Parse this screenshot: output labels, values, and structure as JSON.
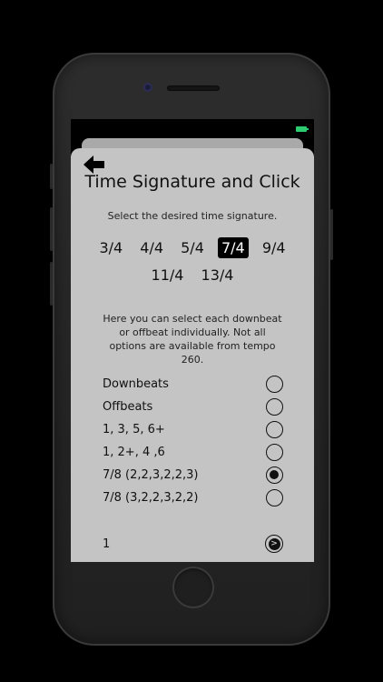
{
  "title": "Time Signature and Click",
  "subtitle": "Select the desired time signature.",
  "signatures_row1": [
    "3/4",
    "4/4",
    "5/4",
    "7/4",
    "9/4"
  ],
  "signatures_row2": [
    "11/4",
    "13/4"
  ],
  "selected_signature": "7/4",
  "info_text": "Here you can select each downbeat or offbeat individually. Not all options are available from tempo 260.",
  "options": [
    {
      "label": "Downbeats",
      "selected": false
    },
    {
      "label": "Offbeats",
      "selected": false
    },
    {
      "label": "1, 3, 5, 6+",
      "selected": false
    },
    {
      "label": "1, 2+, 4 ,6",
      "selected": false
    },
    {
      "label": "7/8 (2,2,3,2,2,3)",
      "selected": true
    },
    {
      "label": "7/8 (3,2,2,3,2,2)",
      "selected": false
    }
  ],
  "count_value": "1",
  "icons": {
    "back": "arrow-left-icon",
    "next": "arrow-right-circle-icon",
    "battery": "battery-icon"
  },
  "colors": {
    "sheet": "#c4c4c4",
    "selected_bg": "#000000",
    "battery": "#2ecc71"
  }
}
